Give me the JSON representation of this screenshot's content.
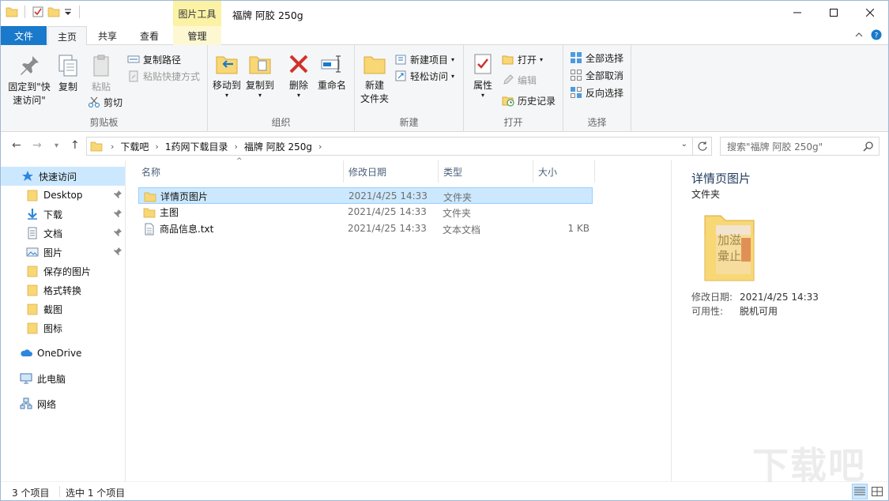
{
  "window": {
    "title": "福牌 阿胶 250g",
    "context_group": "图片工具"
  },
  "tabs": {
    "file": "文件",
    "home": "主页",
    "share": "共享",
    "view": "查看",
    "manage": "管理"
  },
  "ribbon": {
    "clipboard": {
      "label": "剪贴板",
      "pin": "固定到\"快速访问\"",
      "pin_l1": "固定到\"快",
      "pin_l2": "速访问\"",
      "copy": "复制",
      "paste": "粘贴",
      "copy_path": "复制路径",
      "paste_shortcut": "粘贴快捷方式",
      "cut": "剪切"
    },
    "organize": {
      "label": "组织",
      "move_to": "移动到",
      "copy_to": "复制到",
      "delete": "删除",
      "rename": "重命名"
    },
    "new": {
      "label": "新建",
      "new_folder_l1": "新建",
      "new_folder_l2": "文件夹",
      "new_item": "新建项目",
      "easy_access": "轻松访问"
    },
    "open": {
      "label": "打开",
      "properties": "属性",
      "open": "打开",
      "edit": "编辑",
      "history": "历史记录"
    },
    "select": {
      "label": "选择",
      "select_all": "全部选择",
      "select_none": "全部取消",
      "invert": "反向选择"
    }
  },
  "address": {
    "crumbs": [
      "下载吧",
      "1药网下载目录",
      "福牌 阿胶 250g"
    ],
    "search_placeholder": "搜索\"福牌 阿胶 250g\""
  },
  "nav": {
    "quick_access": "快速访问",
    "items": [
      "Desktop",
      "下载",
      "文档",
      "图片",
      "保存的图片",
      "格式转换",
      "截图",
      "图标"
    ],
    "onedrive": "OneDrive",
    "this_pc": "此电脑",
    "network": "网络"
  },
  "columns": {
    "name": "名称",
    "date": "修改日期",
    "type": "类型",
    "size": "大小"
  },
  "files": [
    {
      "name": "详情页图片",
      "date": "2021/4/25 14:33",
      "type": "文件夹",
      "size": ""
    },
    {
      "name": "主图",
      "date": "2021/4/25 14:33",
      "type": "文件夹",
      "size": ""
    },
    {
      "name": "商品信息.txt",
      "date": "2021/4/25 14:33",
      "type": "文本文档",
      "size": "1 KB"
    }
  ],
  "preview": {
    "name": "详情页图片",
    "type": "文件夹",
    "modified_label": "修改日期:",
    "modified_value": "2021/4/25 14:33",
    "availability_label": "可用性:",
    "availability_value": "脱机可用"
  },
  "status": {
    "count": "3 个项目",
    "selected": "选中 1 个项目"
  }
}
